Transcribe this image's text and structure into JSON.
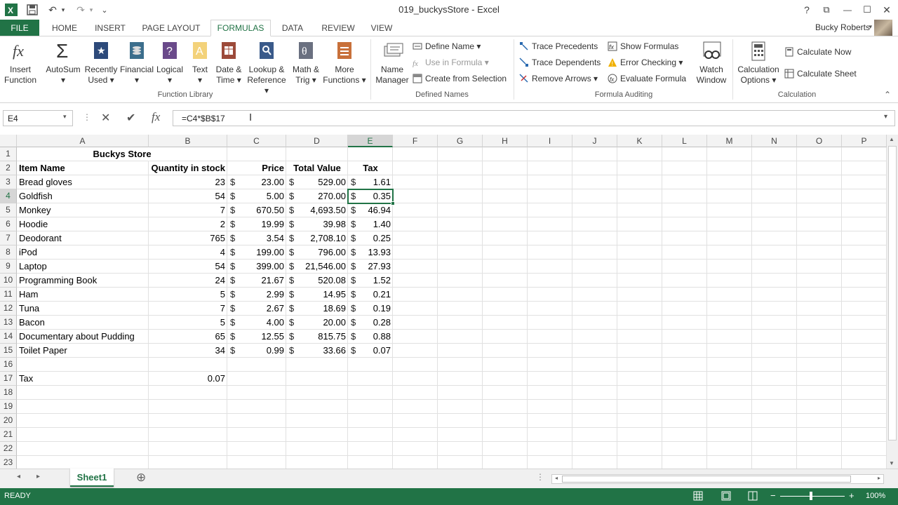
{
  "window": {
    "title": "019_buckysStore - Excel",
    "help": "?",
    "restore": "⧉",
    "minimize": "—",
    "maximize": "☐",
    "close": "✕"
  },
  "qat": {
    "undo": "↶",
    "redo": "↷",
    "more": "⌄"
  },
  "tabs": [
    {
      "label": "FILE"
    },
    {
      "label": "HOME"
    },
    {
      "label": "INSERT"
    },
    {
      "label": "PAGE LAYOUT"
    },
    {
      "label": "FORMULAS"
    },
    {
      "label": "DATA"
    },
    {
      "label": "REVIEW"
    },
    {
      "label": "VIEW"
    }
  ],
  "user": {
    "name": "Bucky Roberts"
  },
  "ribbon": {
    "insert_function": {
      "line1": "Insert",
      "line2": "Function"
    },
    "autosum": {
      "line1": "AutoSum",
      "line2": "▾"
    },
    "recently_used": {
      "line1": "Recently",
      "line2": "Used ▾"
    },
    "financial": {
      "line1": "Financial",
      "line2": "▾"
    },
    "logical": {
      "line1": "Logical",
      "line2": "▾"
    },
    "text": {
      "line1": "Text",
      "line2": "▾"
    },
    "date_time": {
      "line1": "Date &",
      "line2": "Time ▾"
    },
    "lookup": {
      "line1": "Lookup &",
      "line2": "Reference ▾"
    },
    "math": {
      "line1": "Math &",
      "line2": "Trig ▾"
    },
    "more": {
      "line1": "More",
      "line2": "Functions ▾"
    },
    "group_function_library": "Function Library",
    "name_manager": {
      "line1": "Name",
      "line2": "Manager"
    },
    "define_name": "Define Name  ▾",
    "use_in_formula": "Use in Formula ▾",
    "create_from_selection": "Create from Selection",
    "group_defined_names": "Defined Names",
    "trace_precedents": "Trace Precedents",
    "trace_dependents": "Trace Dependents",
    "remove_arrows": "Remove Arrows  ▾",
    "show_formulas": "Show Formulas",
    "error_checking": "Error Checking  ▾",
    "evaluate_formula": "Evaluate Formula",
    "watch_window": {
      "line1": "Watch",
      "line2": "Window"
    },
    "group_formula_auditing": "Formula Auditing",
    "calc_options": {
      "line1": "Calculation",
      "line2": "Options ▾"
    },
    "calculate_now": "Calculate Now",
    "calculate_sheet": "Calculate Sheet",
    "group_calculation": "Calculation"
  },
  "formula_bar": {
    "name_box": "E4",
    "cancel": "✕",
    "enter": "✔",
    "fx": "fx",
    "formula": "=C4*$B$17"
  },
  "columns": [
    "A",
    "B",
    "C",
    "D",
    "E",
    "F",
    "G",
    "H",
    "I",
    "J",
    "K",
    "L",
    "M",
    "N",
    "O",
    "P"
  ],
  "rows": [
    "1",
    "2",
    "3",
    "4",
    "5",
    "6",
    "7",
    "8",
    "9",
    "10",
    "11",
    "12",
    "13",
    "14",
    "15",
    "16",
    "17",
    "18",
    "19",
    "20",
    "21",
    "22",
    "23"
  ],
  "sheet": {
    "title": "Buckys Store",
    "headers": [
      "Item Name",
      "Quantity in stock",
      "Price",
      "Total Value",
      "Tax"
    ],
    "currency": "$",
    "items": [
      {
        "name": "Bread gloves",
        "qty": "23",
        "price": "23.00",
        "total": "529.00",
        "tax": "1.61"
      },
      {
        "name": "Goldfish",
        "qty": "54",
        "price": "5.00",
        "total": "270.00",
        "tax": "0.35"
      },
      {
        "name": "Monkey",
        "qty": "7",
        "price": "670.50",
        "total": "4,693.50",
        "tax": "46.94"
      },
      {
        "name": "Hoodie",
        "qty": "2",
        "price": "19.99",
        "total": "39.98",
        "tax": "1.40"
      },
      {
        "name": "Deodorant",
        "qty": "765",
        "price": "3.54",
        "total": "2,708.10",
        "tax": "0.25"
      },
      {
        "name": "iPod",
        "qty": "4",
        "price": "199.00",
        "total": "796.00",
        "tax": "13.93"
      },
      {
        "name": "Laptop",
        "qty": "54",
        "price": "399.00",
        "total": "21,546.00",
        "tax": "27.93"
      },
      {
        "name": "Programming Book",
        "qty": "24",
        "price": "21.67",
        "total": "520.08",
        "tax": "1.52"
      },
      {
        "name": "Ham",
        "qty": "5",
        "price": "2.99",
        "total": "14.95",
        "tax": "0.21"
      },
      {
        "name": "Tuna",
        "qty": "7",
        "price": "2.67",
        "total": "18.69",
        "tax": "0.19"
      },
      {
        "name": "Bacon",
        "qty": "5",
        "price": "4.00",
        "total": "20.00",
        "tax": "0.28"
      },
      {
        "name": "Documentary about Pudding",
        "qty": "65",
        "price": "12.55",
        "total": "815.75",
        "tax": "0.88"
      },
      {
        "name": "Toilet Paper",
        "qty": "34",
        "price": "0.99",
        "total": "33.66",
        "tax": "0.07"
      }
    ],
    "tax_label": "Tax",
    "tax_rate": "0.07"
  },
  "sheet_tabs": {
    "active": "Sheet1",
    "add": "⊕"
  },
  "status": {
    "text": "READY",
    "zoom": "100%"
  },
  "colors": {
    "accent": "#217346"
  }
}
